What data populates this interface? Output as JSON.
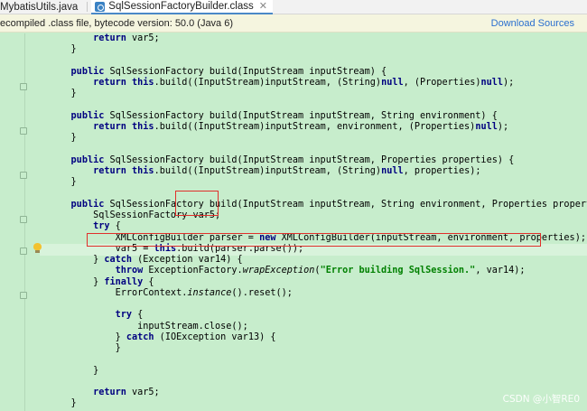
{
  "tabs": [
    {
      "label": "MybatisUtils.java",
      "active": false
    },
    {
      "label": "SqlSessionFactoryBuilder.class",
      "active": true
    }
  ],
  "banner": {
    "text": "ecompiled .class file, bytecode version: 50.0 (Java 6)",
    "link": "Download Sources"
  },
  "code": {
    "lines": [
      "        return var5;",
      "    }",
      "",
      "    public SqlSessionFactory build(InputStream inputStream) {",
      "        return this.build((InputStream)inputStream, (String)null, (Properties)null);",
      "    }",
      "",
      "    public SqlSessionFactory build(InputStream inputStream, String environment) {",
      "        return this.build((InputStream)inputStream, environment, (Properties)null);",
      "    }",
      "",
      "    public SqlSessionFactory build(InputStream inputStream, Properties properties) {",
      "        return this.build((InputStream)inputStream, (String)null, properties);",
      "    }",
      "",
      "    public SqlSessionFactory build(InputStream inputStream, String environment, Properties properties) {",
      "        SqlSessionFactory var5;",
      "        try {",
      "            XMLConfigBuilder parser = new XMLConfigBuilder(inputStream, environment, properties);",
      "            var5 = this.build(parser.parse());",
      "        } catch (Exception var14) {",
      "            throw ExceptionFactory.wrapException(\"Error building SqlSession.\", var14);",
      "        } finally {",
      "            ErrorContext.instance().reset();",
      "",
      "            try {",
      "                inputStream.close();",
      "            } catch (IOException var13) {",
      "            }",
      "",
      "        }",
      "",
      "        return var5;",
      "    }"
    ]
  },
  "watermark": "CSDN @小智RE0",
  "colors": {
    "editor_bg": "#c7edcc",
    "keyword": "#000080",
    "string": "#008000",
    "annotation_box": "#e0302b"
  }
}
